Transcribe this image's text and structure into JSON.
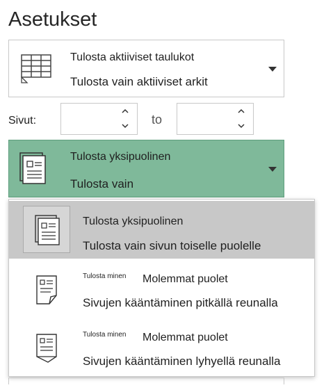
{
  "title": "Asetukset",
  "sheets_dropdown": {
    "icon": "table-grid-icon",
    "line1": "Tulosta aktiiviset taulukot",
    "line2": "Tulosta vain aktiiviset arkit"
  },
  "pages": {
    "label": "Sivut:",
    "from_value": "",
    "to_label": "to",
    "to_value": ""
  },
  "sides_dropdown": {
    "icon": "single-page-icon",
    "line1": "Tulosta yksipuolinen",
    "line2": "Tulosta vain",
    "accent_color": "#7fb99a"
  },
  "menu": {
    "items": [
      {
        "icon": "single-page-icon",
        "title": "Tulosta yksipuolinen",
        "desc": "Tulosta vain sivun toiselle puolelle",
        "selected": true
      },
      {
        "icon": "flip-long-edge-icon",
        "small": "Tulosta minen",
        "title": "Molemmat puolet",
        "desc": "Sivujen kääntäminen pitkällä reunalla",
        "selected": false
      },
      {
        "icon": "flip-short-edge-icon",
        "small": "Tulosta minen",
        "title": "Molemmat puolet",
        "desc": "Sivujen kääntäminen lyhyellä reunalla",
        "selected": false
      }
    ]
  }
}
